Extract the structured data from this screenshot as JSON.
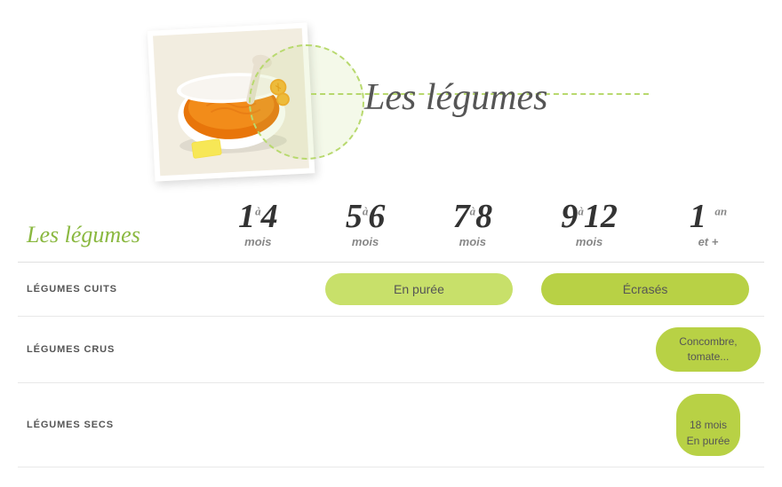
{
  "hero": {
    "title": "Les légumes"
  },
  "table": {
    "section_title": "Les légumes",
    "columns": [
      {
        "id": "label",
        "age_main": "",
        "age_sub": ""
      },
      {
        "id": "1-4",
        "age_num1": "1",
        "age_connector": "à",
        "age_num2": "4",
        "age_sub": "mois"
      },
      {
        "id": "5-6",
        "age_num1": "5",
        "age_connector": "à",
        "age_num2": "6",
        "age_sub": "mois"
      },
      {
        "id": "7-8",
        "age_num1": "7",
        "age_connector": "à",
        "age_num2": "8",
        "age_sub": "mois"
      },
      {
        "id": "9-12",
        "age_num1": "9",
        "age_connector": "à",
        "age_num2": "12",
        "age_sub": "mois"
      },
      {
        "id": "1an",
        "age_num1": "1",
        "age_connector": "an",
        "age_num2": "",
        "age_sub": "et +"
      }
    ],
    "rows": [
      {
        "label": "LÉGUMES CUITS",
        "cells": {
          "1-4": "",
          "5-6+7-8": "En purée",
          "9-12+1an": "Écrasés"
        }
      },
      {
        "label": "LÉGUMES CRUS",
        "cells": {
          "1-4": "",
          "5-6": "",
          "7-8": "",
          "9-12": "",
          "1an": "Concombre, tomate..."
        }
      },
      {
        "label": "LÉGUMES SECS",
        "cells": {
          "1-4": "",
          "5-6": "",
          "7-8": "",
          "9-12": "",
          "1an": "18 mois\nEn purée"
        }
      }
    ]
  }
}
